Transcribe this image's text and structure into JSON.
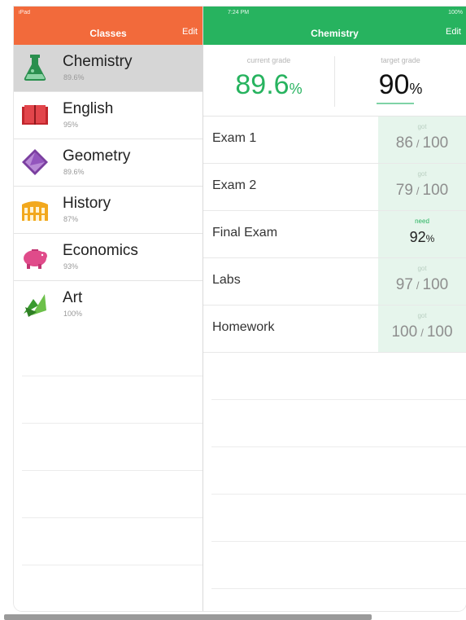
{
  "left_pane": {
    "status_left": "iPad",
    "title": "Classes",
    "edit_label": "Edit"
  },
  "right_pane": {
    "status_time": "7:24 PM",
    "status_battery": "100%",
    "title": "Chemistry",
    "edit_label": "Edit"
  },
  "classes": [
    {
      "name": "Chemistry",
      "grade": "89.6%",
      "icon": "flask-icon",
      "selected": true
    },
    {
      "name": "English",
      "grade": "95%",
      "icon": "book-icon",
      "selected": false
    },
    {
      "name": "Geometry",
      "grade": "89.6%",
      "icon": "octahedron-icon",
      "selected": false
    },
    {
      "name": "History",
      "grade": "87%",
      "icon": "colosseum-icon",
      "selected": false
    },
    {
      "name": "Economics",
      "grade": "93%",
      "icon": "piggy-bank-icon",
      "selected": false
    },
    {
      "name": "Art",
      "grade": "100%",
      "icon": "paint-icon",
      "selected": false
    }
  ],
  "grade_summary": {
    "current_label": "current grade",
    "current_value": "89.6",
    "current_unit": "%",
    "target_label": "target grade",
    "target_value": "90",
    "target_unit": "%"
  },
  "items": [
    {
      "name": "Exam 1",
      "label": "got",
      "score": "86",
      "sep": "/",
      "total": "100"
    },
    {
      "name": "Exam 2",
      "label": "got",
      "score": "79",
      "sep": "/",
      "total": "100"
    },
    {
      "name": "Final Exam",
      "label": "need",
      "score": "92",
      "unit": "%"
    },
    {
      "name": "Labs",
      "label": "got",
      "score": "97",
      "sep": "/",
      "total": "100"
    },
    {
      "name": "Homework",
      "label": "got",
      "score": "100",
      "sep": "/",
      "total": "100"
    }
  ],
  "colors": {
    "left_bar": "#f26a3b",
    "right_bar": "#27b35f",
    "accent_green": "#27b35f"
  }
}
